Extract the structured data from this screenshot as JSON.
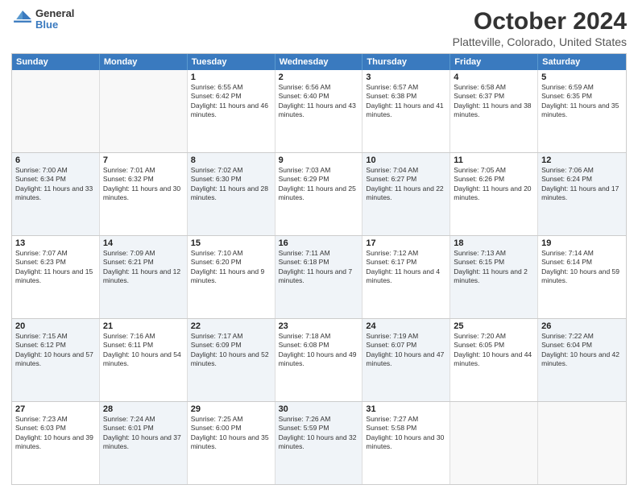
{
  "header": {
    "logo_line1": "General",
    "logo_line2": "Blue",
    "title": "October 2024",
    "subtitle": "Platteville, Colorado, United States"
  },
  "days_of_week": [
    "Sunday",
    "Monday",
    "Tuesday",
    "Wednesday",
    "Thursday",
    "Friday",
    "Saturday"
  ],
  "weeks": [
    [
      {
        "day": "",
        "empty": true
      },
      {
        "day": "",
        "empty": true
      },
      {
        "day": "1",
        "sunrise": "Sunrise: 6:55 AM",
        "sunset": "Sunset: 6:42 PM",
        "daylight": "Daylight: 11 hours and 46 minutes."
      },
      {
        "day": "2",
        "sunrise": "Sunrise: 6:56 AM",
        "sunset": "Sunset: 6:40 PM",
        "daylight": "Daylight: 11 hours and 43 minutes."
      },
      {
        "day": "3",
        "sunrise": "Sunrise: 6:57 AM",
        "sunset": "Sunset: 6:38 PM",
        "daylight": "Daylight: 11 hours and 41 minutes."
      },
      {
        "day": "4",
        "sunrise": "Sunrise: 6:58 AM",
        "sunset": "Sunset: 6:37 PM",
        "daylight": "Daylight: 11 hours and 38 minutes."
      },
      {
        "day": "5",
        "sunrise": "Sunrise: 6:59 AM",
        "sunset": "Sunset: 6:35 PM",
        "daylight": "Daylight: 11 hours and 35 minutes."
      }
    ],
    [
      {
        "day": "6",
        "sunrise": "Sunrise: 7:00 AM",
        "sunset": "Sunset: 6:34 PM",
        "daylight": "Daylight: 11 hours and 33 minutes.",
        "shaded": true
      },
      {
        "day": "7",
        "sunrise": "Sunrise: 7:01 AM",
        "sunset": "Sunset: 6:32 PM",
        "daylight": "Daylight: 11 hours and 30 minutes."
      },
      {
        "day": "8",
        "sunrise": "Sunrise: 7:02 AM",
        "sunset": "Sunset: 6:30 PM",
        "daylight": "Daylight: 11 hours and 28 minutes.",
        "shaded": true
      },
      {
        "day": "9",
        "sunrise": "Sunrise: 7:03 AM",
        "sunset": "Sunset: 6:29 PM",
        "daylight": "Daylight: 11 hours and 25 minutes."
      },
      {
        "day": "10",
        "sunrise": "Sunrise: 7:04 AM",
        "sunset": "Sunset: 6:27 PM",
        "daylight": "Daylight: 11 hours and 22 minutes.",
        "shaded": true
      },
      {
        "day": "11",
        "sunrise": "Sunrise: 7:05 AM",
        "sunset": "Sunset: 6:26 PM",
        "daylight": "Daylight: 11 hours and 20 minutes."
      },
      {
        "day": "12",
        "sunrise": "Sunrise: 7:06 AM",
        "sunset": "Sunset: 6:24 PM",
        "daylight": "Daylight: 11 hours and 17 minutes.",
        "shaded": true
      }
    ],
    [
      {
        "day": "13",
        "sunrise": "Sunrise: 7:07 AM",
        "sunset": "Sunset: 6:23 PM",
        "daylight": "Daylight: 11 hours and 15 minutes."
      },
      {
        "day": "14",
        "sunrise": "Sunrise: 7:09 AM",
        "sunset": "Sunset: 6:21 PM",
        "daylight": "Daylight: 11 hours and 12 minutes.",
        "shaded": true
      },
      {
        "day": "15",
        "sunrise": "Sunrise: 7:10 AM",
        "sunset": "Sunset: 6:20 PM",
        "daylight": "Daylight: 11 hours and 9 minutes."
      },
      {
        "day": "16",
        "sunrise": "Sunrise: 7:11 AM",
        "sunset": "Sunset: 6:18 PM",
        "daylight": "Daylight: 11 hours and 7 minutes.",
        "shaded": true
      },
      {
        "day": "17",
        "sunrise": "Sunrise: 7:12 AM",
        "sunset": "Sunset: 6:17 PM",
        "daylight": "Daylight: 11 hours and 4 minutes."
      },
      {
        "day": "18",
        "sunrise": "Sunrise: 7:13 AM",
        "sunset": "Sunset: 6:15 PM",
        "daylight": "Daylight: 11 hours and 2 minutes.",
        "shaded": true
      },
      {
        "day": "19",
        "sunrise": "Sunrise: 7:14 AM",
        "sunset": "Sunset: 6:14 PM",
        "daylight": "Daylight: 10 hours and 59 minutes."
      }
    ],
    [
      {
        "day": "20",
        "sunrise": "Sunrise: 7:15 AM",
        "sunset": "Sunset: 6:12 PM",
        "daylight": "Daylight: 10 hours and 57 minutes.",
        "shaded": true
      },
      {
        "day": "21",
        "sunrise": "Sunrise: 7:16 AM",
        "sunset": "Sunset: 6:11 PM",
        "daylight": "Daylight: 10 hours and 54 minutes."
      },
      {
        "day": "22",
        "sunrise": "Sunrise: 7:17 AM",
        "sunset": "Sunset: 6:09 PM",
        "daylight": "Daylight: 10 hours and 52 minutes.",
        "shaded": true
      },
      {
        "day": "23",
        "sunrise": "Sunrise: 7:18 AM",
        "sunset": "Sunset: 6:08 PM",
        "daylight": "Daylight: 10 hours and 49 minutes."
      },
      {
        "day": "24",
        "sunrise": "Sunrise: 7:19 AM",
        "sunset": "Sunset: 6:07 PM",
        "daylight": "Daylight: 10 hours and 47 minutes.",
        "shaded": true
      },
      {
        "day": "25",
        "sunrise": "Sunrise: 7:20 AM",
        "sunset": "Sunset: 6:05 PM",
        "daylight": "Daylight: 10 hours and 44 minutes."
      },
      {
        "day": "26",
        "sunrise": "Sunrise: 7:22 AM",
        "sunset": "Sunset: 6:04 PM",
        "daylight": "Daylight: 10 hours and 42 minutes.",
        "shaded": true
      }
    ],
    [
      {
        "day": "27",
        "sunrise": "Sunrise: 7:23 AM",
        "sunset": "Sunset: 6:03 PM",
        "daylight": "Daylight: 10 hours and 39 minutes."
      },
      {
        "day": "28",
        "sunrise": "Sunrise: 7:24 AM",
        "sunset": "Sunset: 6:01 PM",
        "daylight": "Daylight: 10 hours and 37 minutes.",
        "shaded": true
      },
      {
        "day": "29",
        "sunrise": "Sunrise: 7:25 AM",
        "sunset": "Sunset: 6:00 PM",
        "daylight": "Daylight: 10 hours and 35 minutes."
      },
      {
        "day": "30",
        "sunrise": "Sunrise: 7:26 AM",
        "sunset": "Sunset: 5:59 PM",
        "daylight": "Daylight: 10 hours and 32 minutes.",
        "shaded": true
      },
      {
        "day": "31",
        "sunrise": "Sunrise: 7:27 AM",
        "sunset": "Sunset: 5:58 PM",
        "daylight": "Daylight: 10 hours and 30 minutes."
      },
      {
        "day": "",
        "empty": true
      },
      {
        "day": "",
        "empty": true
      }
    ]
  ]
}
